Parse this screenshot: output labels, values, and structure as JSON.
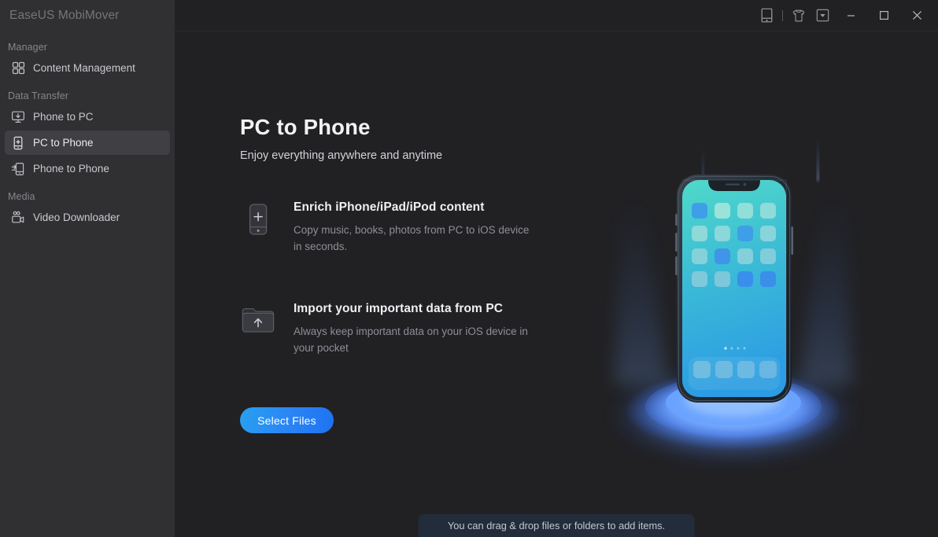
{
  "app": {
    "brand": "EaseUS MobiMover"
  },
  "titlebar": {
    "buttons": [
      {
        "name": "device-icon",
        "label": ""
      },
      {
        "name": "theme-shirt-icon",
        "label": ""
      },
      {
        "name": "more-dropdown-icon",
        "label": ""
      }
    ],
    "window_controls": [
      {
        "name": "minimize-button",
        "label": "—"
      },
      {
        "name": "maximize-button",
        "label": "□"
      },
      {
        "name": "close-button",
        "label": "✕"
      }
    ]
  },
  "sidebar": {
    "sections": [
      {
        "label": "Manager",
        "items": [
          {
            "label": "Content Management",
            "icon": "grid-icon",
            "active": false
          }
        ]
      },
      {
        "label": "Data Transfer",
        "items": [
          {
            "label": "Phone to PC",
            "icon": "monitor-download-icon",
            "active": false
          },
          {
            "label": "PC to Phone",
            "icon": "phone-plus-icon",
            "active": true
          },
          {
            "label": "Phone to Phone",
            "icon": "phone-transfer-icon",
            "active": false
          }
        ]
      },
      {
        "label": "Media",
        "items": [
          {
            "label": "Video Downloader",
            "icon": "video-camera-icon",
            "active": false
          }
        ]
      }
    ]
  },
  "main": {
    "title": "PC to Phone",
    "subtitle": "Enjoy everything anywhere and anytime",
    "features": [
      {
        "icon": "phone-plus-icon",
        "title": "Enrich iPhone/iPad/iPod content",
        "desc": "Copy music, books, photos from PC to iOS device in seconds."
      },
      {
        "icon": "folder-upload-icon",
        "title": "Import your important data from PC",
        "desc": "Always keep important data on your iOS device in your pocket"
      }
    ],
    "primary_button": "Select Files",
    "toast": "You can drag & drop files or folders to add items."
  },
  "colors": {
    "sidebar_bg": "#303033",
    "main_bg": "#212124",
    "accent": "#2a87f5",
    "active_item_bg": "#3f3f44",
    "toast_bg": "#222c3a",
    "phone_screen_top": "#4ad5c8",
    "phone_screen_bottom": "#2d9fe0",
    "glow": "#4b8ffb"
  }
}
